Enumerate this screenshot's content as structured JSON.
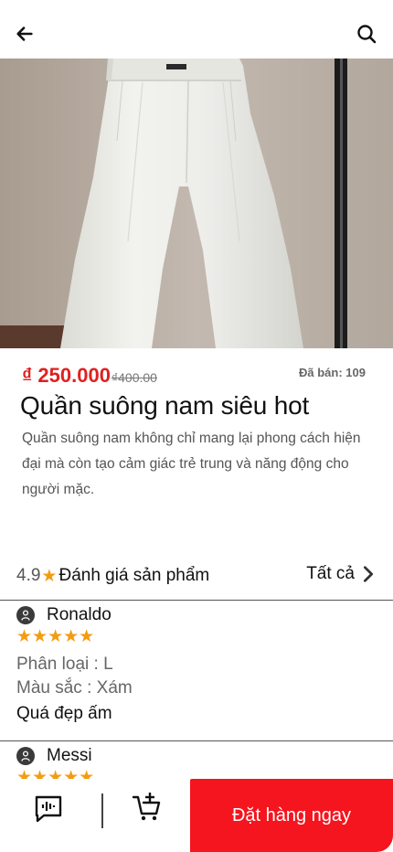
{
  "icons": {
    "back": "arrow-left-icon",
    "search": "search-icon",
    "chat": "chat-icon",
    "cart": "add-to-cart-icon"
  },
  "colors": {
    "accent": "#f4151e",
    "price": "#e02020",
    "star": "#f39c12"
  },
  "product": {
    "price": "₫ 250.000",
    "old_price": "₫400.00",
    "sold_label": "Đã bán:",
    "sold_count": "109",
    "title": "Quần suông nam siêu hot",
    "description": "Quần suông nam không chỉ mang lại phong cách hiện đại mà còn tạo cảm giác trẻ trung và năng động cho người mặc."
  },
  "rating": {
    "score": "4.9",
    "star": "★",
    "title": "Đánh giá sản phẩm",
    "see_all": "Tất cả"
  },
  "reviews": [
    {
      "name": "Ronaldo",
      "stars": "★★★★★",
      "variant_type": "Phân loại : L",
      "variant_color": "Màu sắc : Xám",
      "comment": "Quá đẹp ấm"
    },
    {
      "name": "Messi",
      "stars": "★★★★★"
    }
  ],
  "bottom_bar": {
    "order_label": "Đặt hàng ngay"
  }
}
